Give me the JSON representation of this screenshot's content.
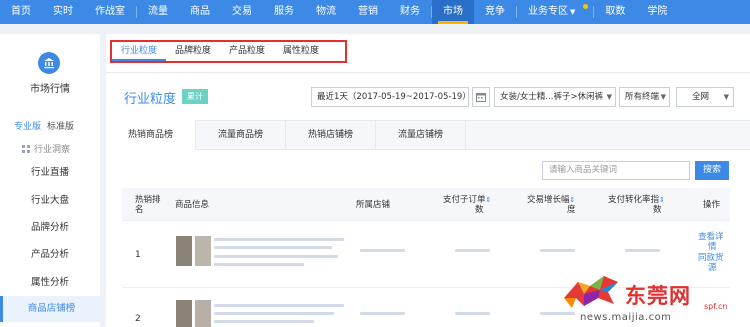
{
  "topnav": {
    "items": [
      "首页",
      "实时",
      "作战室",
      "流量",
      "商品",
      "交易",
      "服务",
      "物流",
      "营销",
      "财务",
      "市场",
      "竞争",
      "业务专区",
      "取数",
      "学院"
    ],
    "active": "市场"
  },
  "sidebar": {
    "title": "市场行情",
    "tab_pro": "专业版",
    "tab_std": "标准版",
    "group": "行业洞察",
    "items": [
      "行业直播",
      "行业大盘",
      "品牌分析",
      "产品分析",
      "属性分析",
      "商品店铺榜"
    ],
    "active_item": "商品店铺榜"
  },
  "subtabs": [
    "行业粒度",
    "品牌粒度",
    "产品粒度",
    "属性粒度"
  ],
  "section": {
    "title": "行业粒度",
    "badge": "累计"
  },
  "filters": {
    "date": "最近1天（2017-05-19~2017-05-19）",
    "category": "女装/女士精...裤子>休闲裤",
    "terminal": "所有终端",
    "region": "全网"
  },
  "tabs": [
    "热销商品榜",
    "流量商品榜",
    "热销店铺榜",
    "流量店铺榜"
  ],
  "search": {
    "placeholder": "请输入商品关键词",
    "button": "搜索"
  },
  "table": {
    "headers": {
      "rank_1": "热销排",
      "rank_2": "名",
      "product": "商品信息",
      "shop": "所属店铺",
      "paid_1": "支付子订单",
      "paid_2": "数",
      "growth_1": "交易增长幅",
      "growth_2": "度",
      "conv_1": "支付转化率指",
      "conv_2": "数",
      "op": "操作"
    },
    "rows": [
      {
        "rank": "1",
        "op": [
          "查看详",
          "情",
          "同款货",
          "源"
        ]
      },
      {
        "rank": "2",
        "op": []
      }
    ]
  },
  "watermark": {
    "brand": "东莞网",
    "url": "news.maijia.com",
    "site": "spf.cn"
  },
  "colors": {
    "accent": "#3d8ae6",
    "highlight_border": "#e03030",
    "badge": "#6bd3c4"
  }
}
